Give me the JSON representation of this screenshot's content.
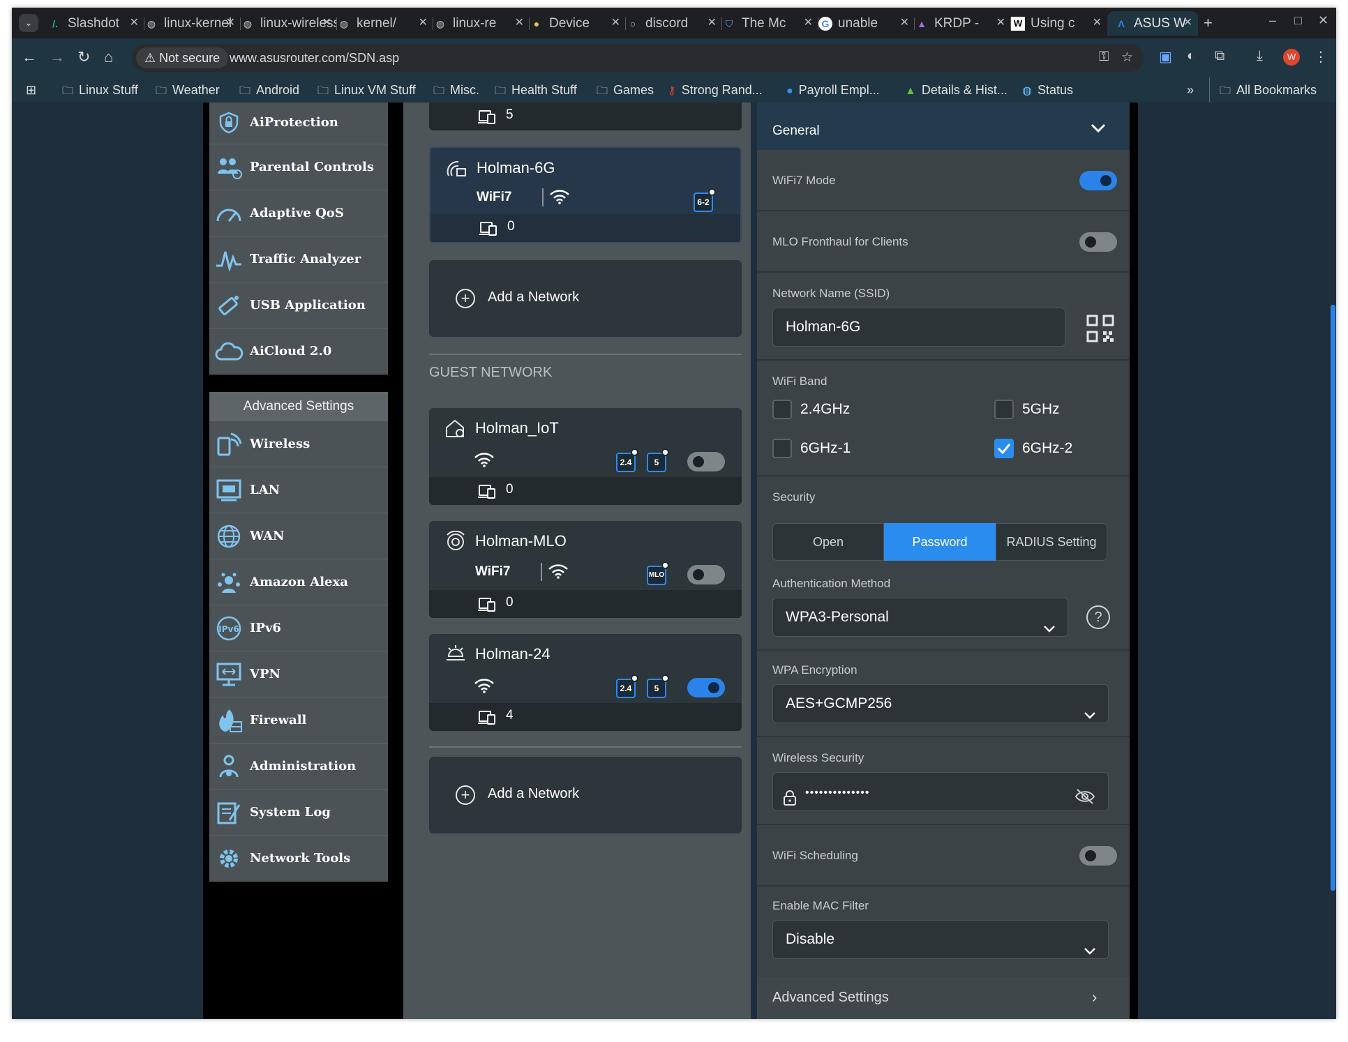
{
  "browser": {
    "tabs": [
      {
        "title": "Slashdot",
        "icon": "slashdot-icon"
      },
      {
        "title": "linux-kernel",
        "icon": "globe-icon"
      },
      {
        "title": "linux-wireless",
        "icon": "globe-icon"
      },
      {
        "title": "kernel/",
        "icon": "globe-icon"
      },
      {
        "title": "linux-re",
        "icon": "globe-icon"
      },
      {
        "title": "Device",
        "icon": "device-icon"
      },
      {
        "title": "discord",
        "icon": "github-icon"
      },
      {
        "title": "The Mc",
        "icon": "shield-icon"
      },
      {
        "title": "unable",
        "icon": "google-icon"
      },
      {
        "title": "KRDP -",
        "icon": "triangle-icon"
      },
      {
        "title": "Using c",
        "icon": "wikipedia-icon"
      },
      {
        "title": "ASUS W",
        "icon": "asus-icon"
      }
    ],
    "not_secure_label": "Not secure",
    "url": "www.asusrouter.com/SDN.asp",
    "bookmarks": [
      {
        "label": "Linux Stuff",
        "icon": "folder-icon"
      },
      {
        "label": "Weather",
        "icon": "folder-icon"
      },
      {
        "label": "Android",
        "icon": "folder-icon"
      },
      {
        "label": "Linux VM Stuff",
        "icon": "folder-icon"
      },
      {
        "label": "Misc.",
        "icon": "folder-icon"
      },
      {
        "label": "Health Stuff",
        "icon": "folder-icon"
      },
      {
        "label": "Games",
        "icon": "folder-icon"
      },
      {
        "label": "Strong Rand...",
        "icon": "key-icon"
      },
      {
        "label": "Payroll Empl...",
        "icon": "circle-icon"
      },
      {
        "label": "Details & Hist...",
        "icon": "mountain-icon"
      },
      {
        "label": "Status",
        "icon": "globe-icon"
      }
    ],
    "more_label": "»",
    "all_bookmarks_label": "All Bookmarks",
    "profile_initial": "W"
  },
  "sidebar": {
    "top_items": [
      {
        "label": "AiProtection",
        "icon": "shield-lock-icon"
      },
      {
        "label": "Parental Controls",
        "icon": "family-icon"
      },
      {
        "label": "Adaptive QoS",
        "icon": "speedometer-icon"
      },
      {
        "label": "Traffic Analyzer",
        "icon": "pulse-icon"
      },
      {
        "label": "USB Application",
        "icon": "usb-icon"
      },
      {
        "label": "AiCloud 2.0",
        "icon": "cloud-icon"
      }
    ],
    "advanced_header": "Advanced Settings",
    "advanced_items": [
      {
        "label": "Wireless",
        "icon": "wireless-icon"
      },
      {
        "label": "LAN",
        "icon": "lan-icon"
      },
      {
        "label": "WAN",
        "icon": "globe-icon"
      },
      {
        "label": "Amazon Alexa",
        "icon": "alexa-icon"
      },
      {
        "label": "IPv6",
        "icon": "ipv6-icon"
      },
      {
        "label": "VPN",
        "icon": "vpn-icon"
      },
      {
        "label": "Firewall",
        "icon": "firewall-icon"
      },
      {
        "label": "Administration",
        "icon": "admin-icon"
      },
      {
        "label": "System Log",
        "icon": "log-icon"
      },
      {
        "label": "Network Tools",
        "icon": "tools-icon"
      }
    ]
  },
  "networks": {
    "top_card_count": "5",
    "main": {
      "name": "Holman-6G",
      "wifi7_label": "WiFi7",
      "band_badge": "6-2",
      "count": "0"
    },
    "add_label": "Add a Network",
    "guest_header": "GUEST NETWORK",
    "guests": [
      {
        "name": "Holman_IoT",
        "badges": [
          "2.4",
          "5"
        ],
        "enabled": false,
        "count": "0",
        "wifi7": false
      },
      {
        "name": "Holman-MLO",
        "badges": [
          "MLO"
        ],
        "enabled": false,
        "count": "0",
        "wifi7": true
      },
      {
        "name": "Holman-24",
        "badges": [
          "2.4",
          "5"
        ],
        "enabled": true,
        "count": "4",
        "wifi7": false
      }
    ]
  },
  "settings": {
    "section_title": "General",
    "wifi7_mode_label": "WiFi7 Mode",
    "wifi7_mode": true,
    "mlo_label": "MLO Fronthaul for Clients",
    "mlo": false,
    "ssid_label": "Network Name (SSID)",
    "ssid_value": "Holman-6G",
    "band_label": "WiFi Band",
    "bands": [
      {
        "label": "2.4GHz",
        "checked": false
      },
      {
        "label": "5GHz",
        "checked": false
      },
      {
        "label": "6GHz-1",
        "checked": false
      },
      {
        "label": "6GHz-2",
        "checked": true
      }
    ],
    "security_label": "Security",
    "security_options": [
      "Open",
      "Password",
      "RADIUS Setting"
    ],
    "security_selected": "Password",
    "auth_label": "Authentication Method",
    "auth_value": "WPA3-Personal",
    "help_glyph": "?",
    "enc_label": "WPA Encryption",
    "enc_value": "AES+GCMP256",
    "wsec_label": "Wireless Security",
    "wsec_value": "••••••••••••••",
    "sched_label": "WiFi Scheduling",
    "sched": false,
    "mac_label": "Enable MAC Filter",
    "mac_value": "Disable",
    "advanced_label": "Advanced Settings"
  },
  "colors": {
    "accent": "#2b82e8",
    "panel": "#3b4347",
    "card": "#2d363b"
  }
}
